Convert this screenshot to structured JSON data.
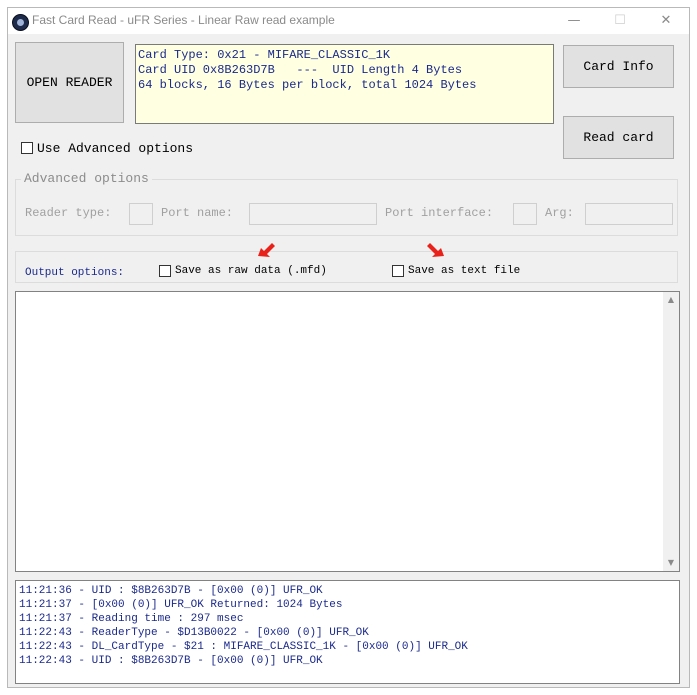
{
  "window": {
    "title": "Fast Card Read - uFR Series - Linear Raw read example",
    "minimize_glyph": "—",
    "maximize_glyph": "☐",
    "close_glyph": "✕"
  },
  "buttons": {
    "open_reader": "OPEN READER",
    "card_info": "Card Info",
    "read_card": "Read card"
  },
  "card_info": {
    "lines": [
      "Card Type: 0x21 - MIFARE_CLASSIC_1K",
      "Card UID 0x8B263D7B   ---  UID Length 4 Bytes",
      "64 blocks, 16 Bytes per block, total 1024 Bytes"
    ]
  },
  "advanced": {
    "checkbox_label": "Use Advanced options",
    "checked": false,
    "group_title": "Advanced options",
    "reader_type_label": "Reader type:",
    "port_name_label": "Port name:",
    "port_interface_label": "Port interface:",
    "arg_label": "Arg:",
    "reader_type_value": "",
    "port_name_value": "",
    "port_interface_value": "",
    "arg_value": ""
  },
  "output_options": {
    "label": "Output options:",
    "raw_label": "Save as raw data (.mfd)",
    "text_label": "Save as text file",
    "raw_checked": false,
    "text_checked": false
  },
  "output_area": {
    "text": "",
    "scroll_up_glyph": "▲",
    "scroll_down_glyph": "▼"
  },
  "log": {
    "lines": [
      "11:21:36 - UID : $8B263D7B - [0x00 (0)] UFR_OK",
      "11:21:37 - [0x00 (0)] UFR_OK Returned: 1024 Bytes",
      "11:21:37 - Reading time : 297 msec",
      "11:22:43 - ReaderType - $D13B0022 - [0x00 (0)] UFR_OK",
      "11:22:43 - DL_CardType - $21 : MIFARE_CLASSIC_1K - [0x00 (0)] UFR_OK",
      "11:22:43 - UID : $8B263D7B - [0x00 (0)] UFR_OK"
    ]
  },
  "colors": {
    "info_text": "#1b2a8c",
    "info_bg": "#ffffe1",
    "annotation_arrow": "#e8221b"
  }
}
